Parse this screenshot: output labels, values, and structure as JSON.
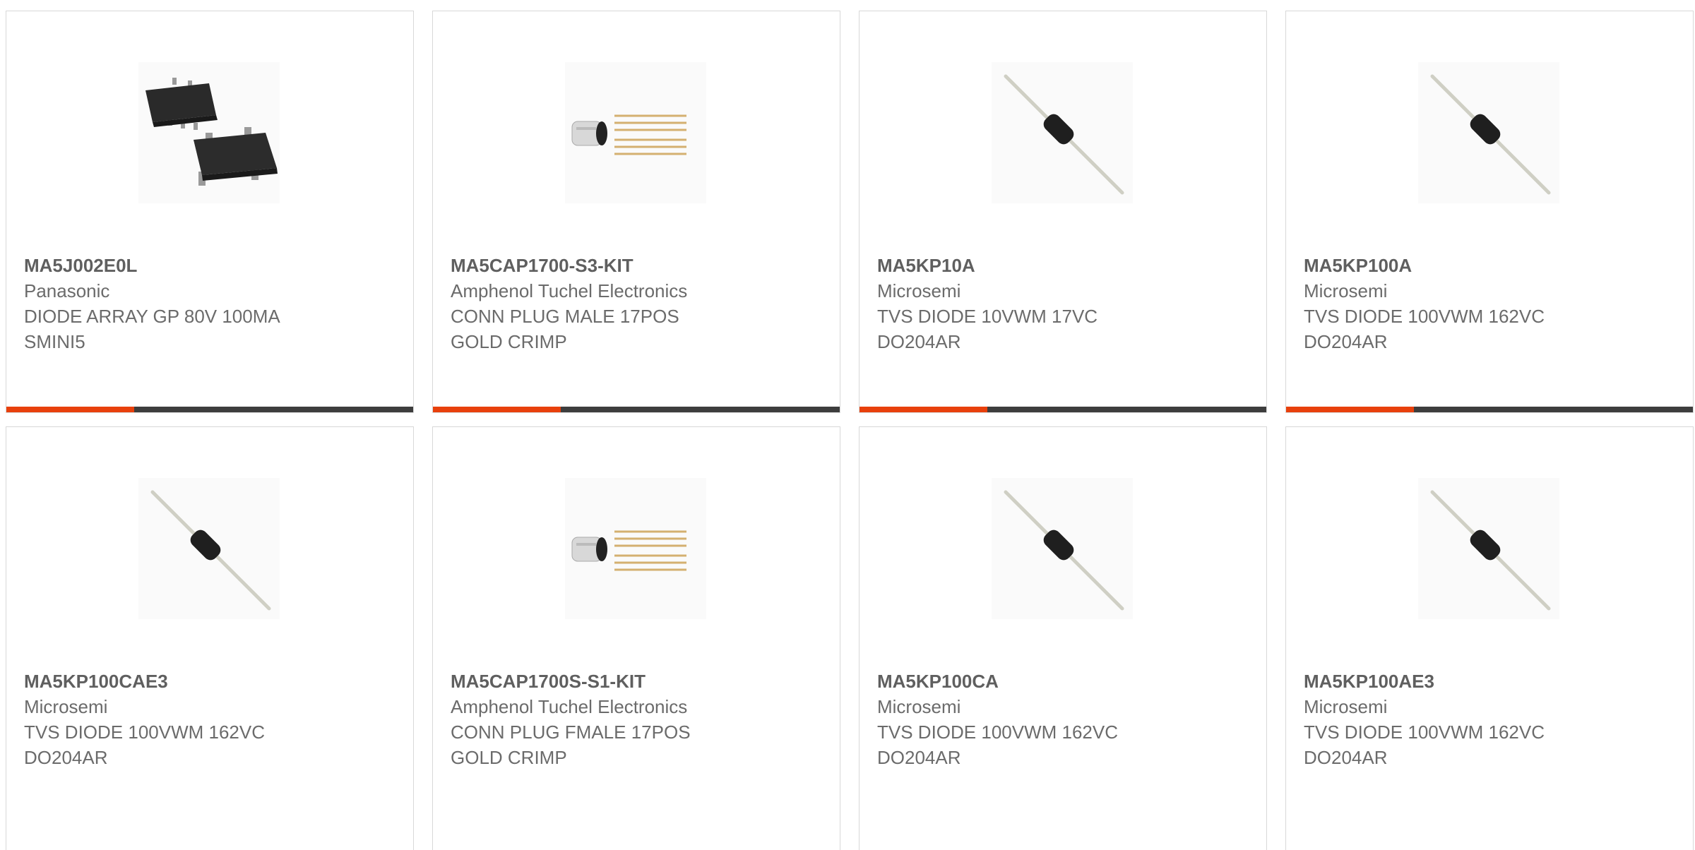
{
  "colors": {
    "accent": "#e8400c",
    "bar": "#3d3d3d",
    "text": "#6b6b6b",
    "border": "#d8d8d8"
  },
  "products": [
    {
      "part": "MA5J002E0L",
      "manufacturer": "Panasonic",
      "description": "DIODE ARRAY GP 80V 100MA\nSMINI5",
      "image": "sot-package-image",
      "progress": 0.315
    },
    {
      "part": "MA5CAP1700-S3-KIT",
      "manufacturer": "Amphenol Tuchel Electronics",
      "description": "CONN PLUG MALE 17POS\nGOLD CRIMP",
      "image": "connector-kit-image",
      "progress": 0.315
    },
    {
      "part": "MA5KP10A",
      "manufacturer": "Microsemi",
      "description": "TVS DIODE 10VWM 17VC\nDO204AR",
      "image": "axial-diode-image",
      "progress": 0.315
    },
    {
      "part": "MA5KP100A",
      "manufacturer": "Microsemi",
      "description": "TVS DIODE 100VWM 162VC\nDO204AR",
      "image": "axial-diode-image",
      "progress": 0.315
    },
    {
      "part": "MA5KP100CAE3",
      "manufacturer": "Microsemi",
      "description": "TVS DIODE 100VWM 162VC\nDO204AR",
      "image": "axial-diode-image"
    },
    {
      "part": "MA5CAP1700S-S1-KIT",
      "manufacturer": "Amphenol Tuchel Electronics",
      "description": "CONN PLUG FMALE 17POS\nGOLD CRIMP",
      "image": "connector-kit-image"
    },
    {
      "part": "MA5KP100CA",
      "manufacturer": "Microsemi",
      "description": "TVS DIODE 100VWM 162VC\nDO204AR",
      "image": "axial-diode-image"
    },
    {
      "part": "MA5KP100AE3",
      "manufacturer": "Microsemi",
      "description": "TVS DIODE 100VWM 162VC\nDO204AR",
      "image": "axial-diode-image"
    }
  ]
}
